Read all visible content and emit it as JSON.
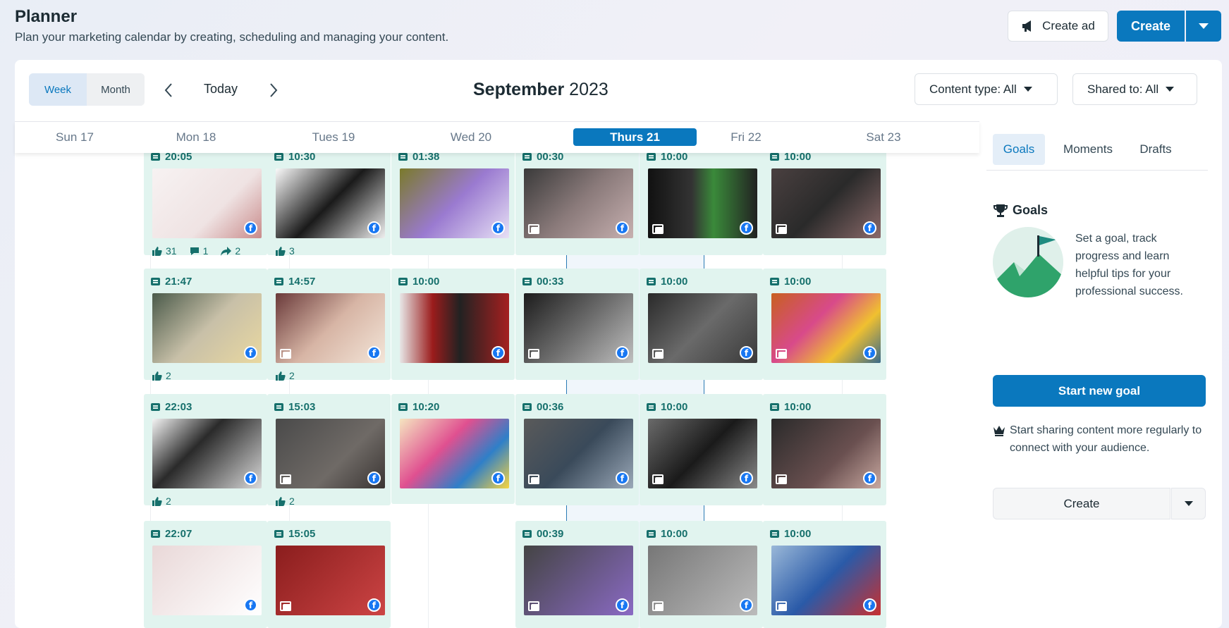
{
  "header": {
    "title": "Planner",
    "subtitle": "Plan your marketing calendar by creating, scheduling and managing your content.",
    "create_ad_label": "Create ad",
    "create_label": "Create"
  },
  "toolbar": {
    "view_week": "Week",
    "view_month": "Month",
    "active_view": "Week",
    "today_label": "Today",
    "month_bold": "September",
    "year": "2023",
    "content_type_label": "Content type: All",
    "shared_to_label": "Shared to: All"
  },
  "days": [
    {
      "label": "Sun 17",
      "today": false
    },
    {
      "label": "Mon 18",
      "today": false
    },
    {
      "label": "Tues 19",
      "today": false
    },
    {
      "label": "Wed 20",
      "today": false
    },
    {
      "label": "Thurs 21",
      "today": true
    },
    {
      "label": "Fri 22",
      "today": false
    },
    {
      "label": "Sat 23",
      "today": false
    }
  ],
  "posts": {
    "mon": [
      {
        "time": "20:05",
        "likes": "31",
        "comments": "1",
        "shares": "2"
      },
      {
        "time": "21:47",
        "likes": "2"
      },
      {
        "time": "22:03",
        "likes": "2"
      },
      {
        "time": "22:07"
      }
    ],
    "tue": [
      {
        "time": "10:30",
        "likes": "3"
      },
      {
        "time": "14:57",
        "likes": "2"
      },
      {
        "time": "15:03",
        "likes": "2"
      },
      {
        "time": "15:05"
      }
    ],
    "wed": [
      {
        "time": "01:38"
      },
      {
        "time": "10:00"
      },
      {
        "time": "10:20"
      }
    ],
    "thu": [
      {
        "time": "00:30"
      },
      {
        "time": "00:33"
      },
      {
        "time": "00:36"
      },
      {
        "time": "00:39"
      }
    ],
    "fri": [
      {
        "time": "10:00"
      },
      {
        "time": "10:00"
      },
      {
        "time": "10:00"
      },
      {
        "time": "10:00"
      }
    ],
    "sat": [
      {
        "time": "10:00"
      },
      {
        "time": "10:00"
      },
      {
        "time": "10:00"
      },
      {
        "time": "10:00"
      }
    ]
  },
  "sidebar": {
    "tabs": [
      "Goals",
      "Moments",
      "Drafts"
    ],
    "active_tab": "Goals",
    "goals_heading": "Goals",
    "goals_text": "Set a goal, track progress and learn helpful tips for your professional success.",
    "start_goal_label": "Start new goal",
    "share_text": "Start sharing content more regularly to connect with your audience.",
    "create_label": "Create"
  },
  "colors": {
    "accent": "#0a78be",
    "post_bg": "#e1f4ef",
    "post_text": "#16706c"
  }
}
